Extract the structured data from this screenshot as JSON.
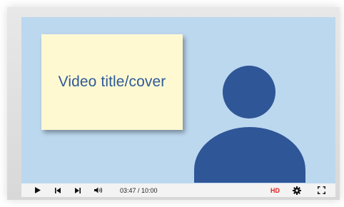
{
  "video": {
    "cover_title": "Video title/cover"
  },
  "controls": {
    "time_display": "03:47 / 10:00",
    "quality_badge": "HD",
    "icons": [
      "play-icon",
      "skip-previous-icon",
      "skip-next-icon",
      "volume-icon",
      "settings-icon",
      "fullscreen-icon"
    ]
  },
  "colors": {
    "player_background": "#bcd8ef",
    "cover_background": "#fff9d2",
    "accent_blue": "#2f5697",
    "hd_red": "#e02020"
  }
}
